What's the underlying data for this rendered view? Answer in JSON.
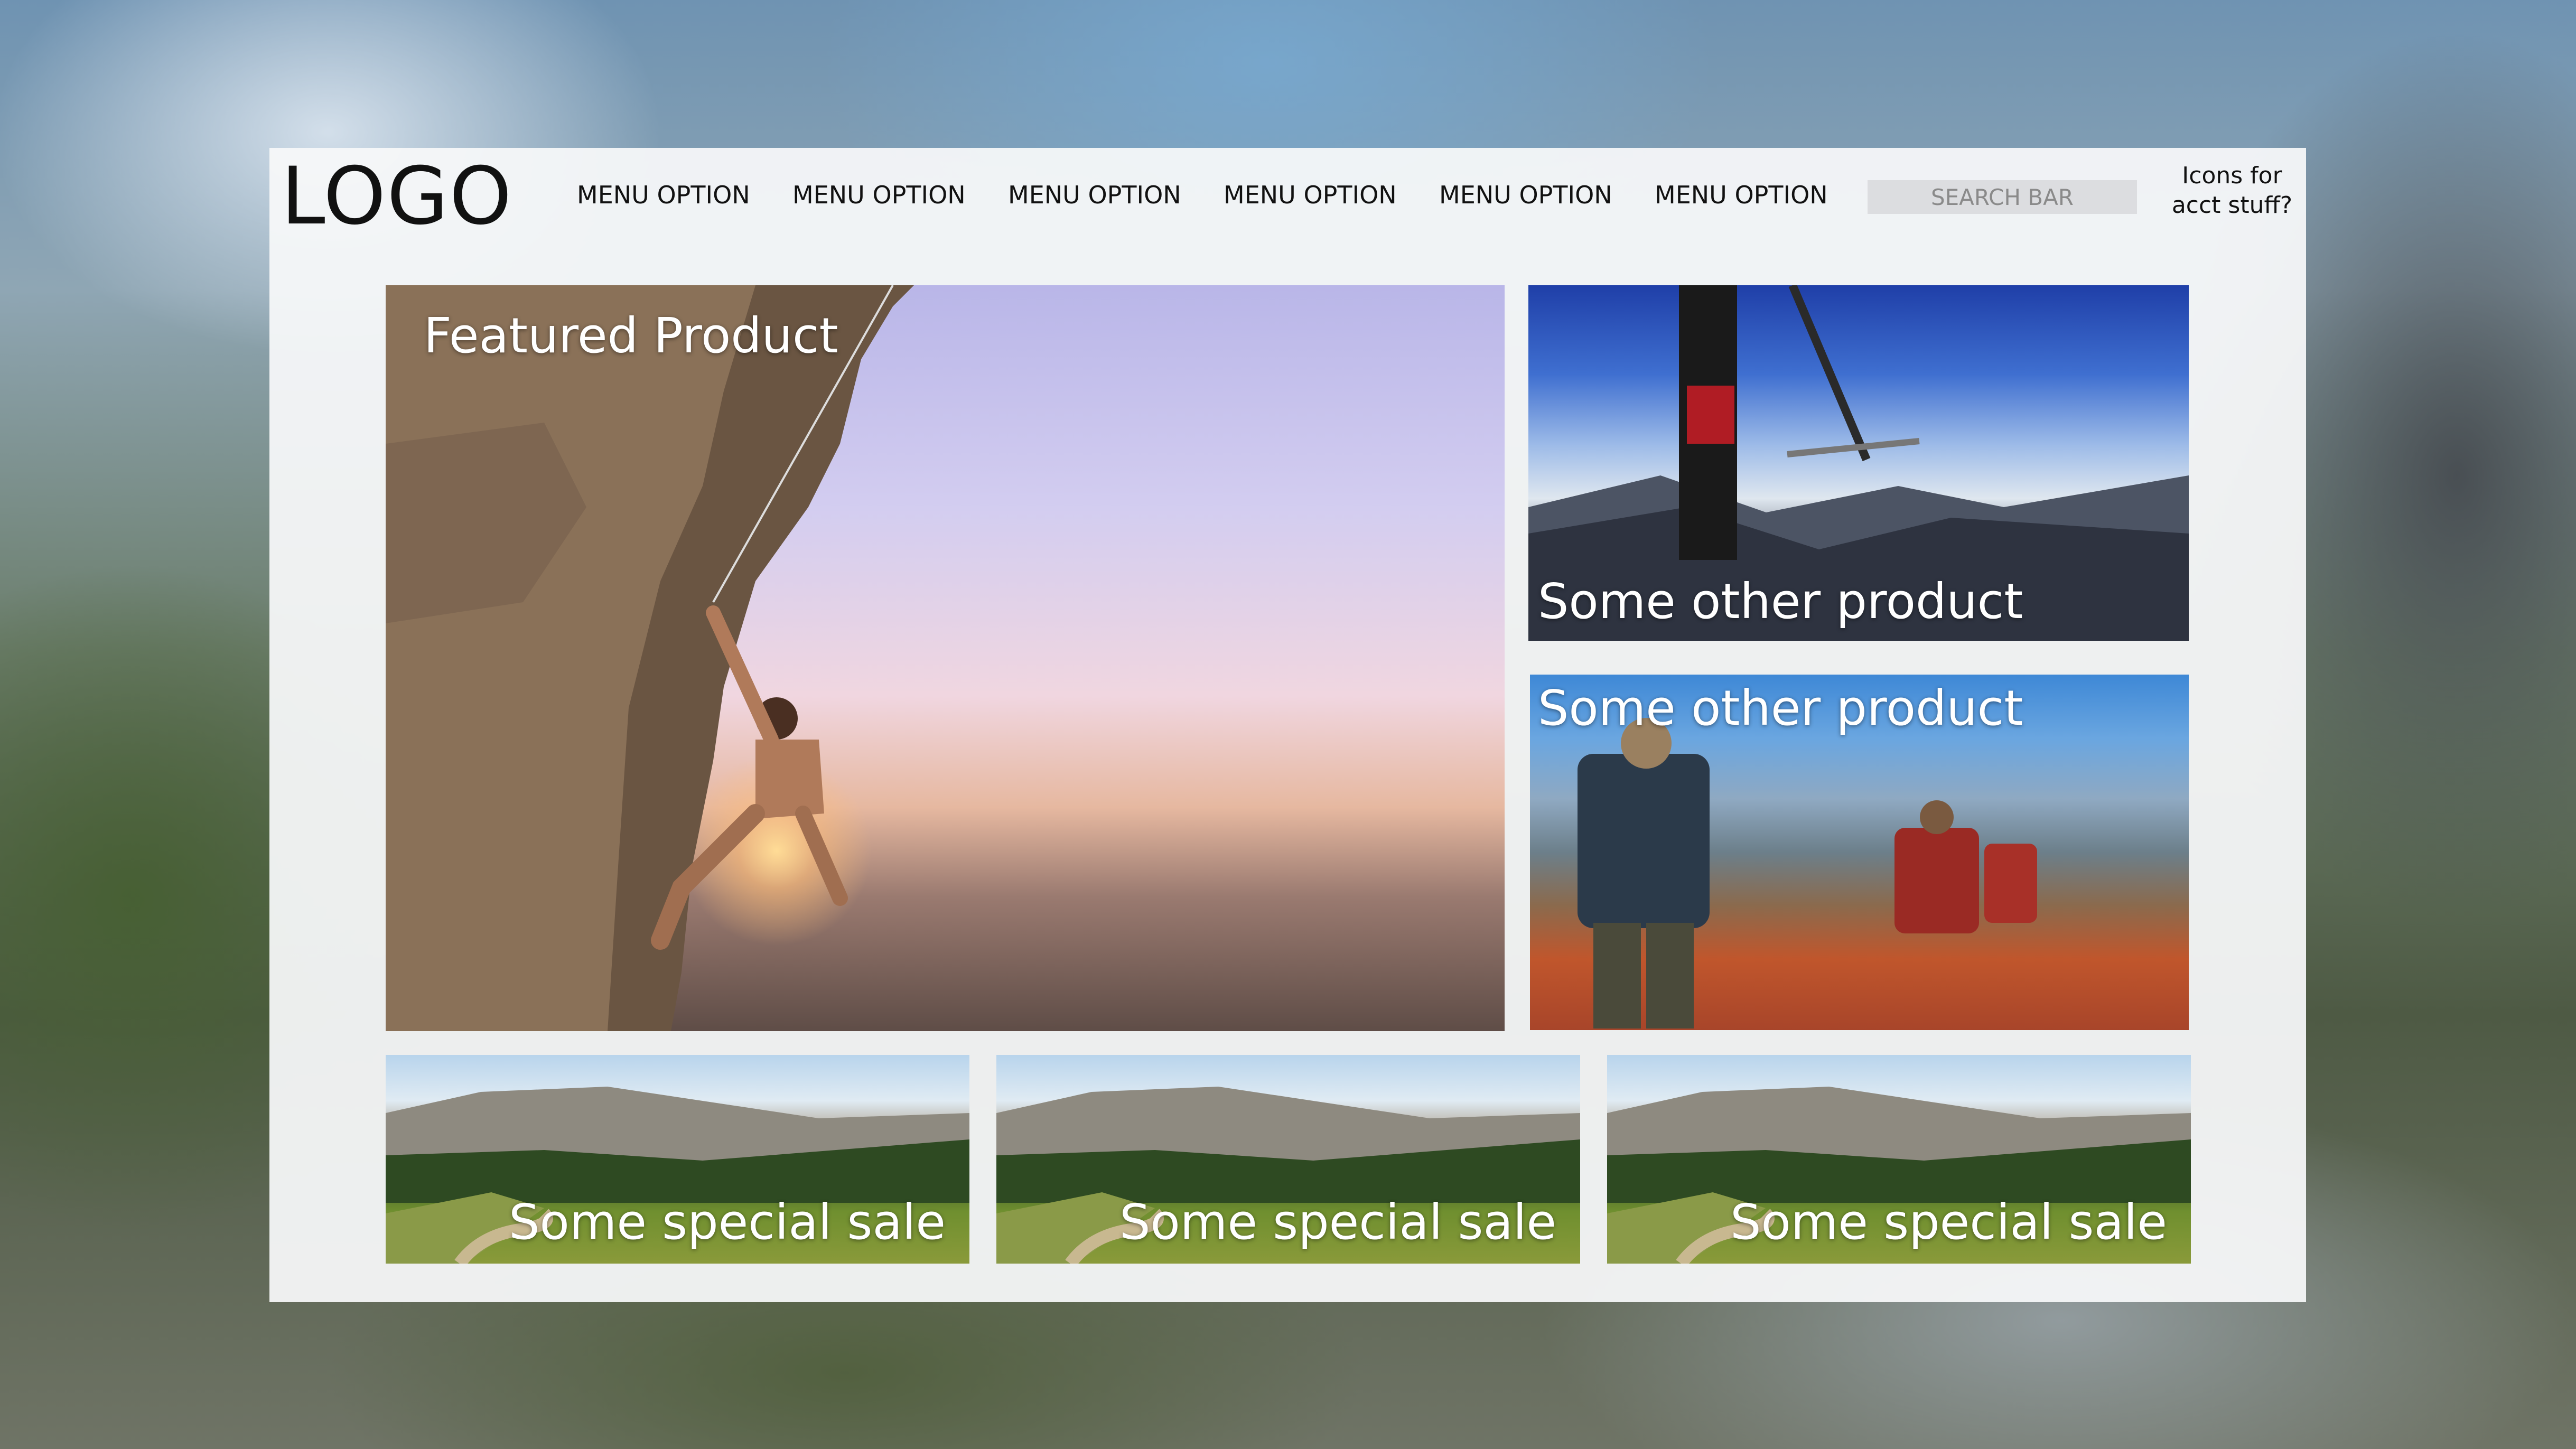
{
  "header": {
    "logo": "LOGO",
    "menu": [
      "MENU OPTION",
      "MENU OPTION",
      "MENU OPTION",
      "MENU OPTION",
      "MENU OPTION",
      "MENU OPTION"
    ],
    "search_placeholder": "SEARCH BAR",
    "account_line1": "Icons for",
    "account_line2": "acct stuff?"
  },
  "featured": {
    "label": "Featured Product"
  },
  "products": [
    {
      "label": "Some other product"
    },
    {
      "label": "Some other product"
    }
  ],
  "sales": [
    {
      "label": "Some special sale"
    },
    {
      "label": "Some special sale"
    },
    {
      "label": "Some special sale"
    }
  ]
}
